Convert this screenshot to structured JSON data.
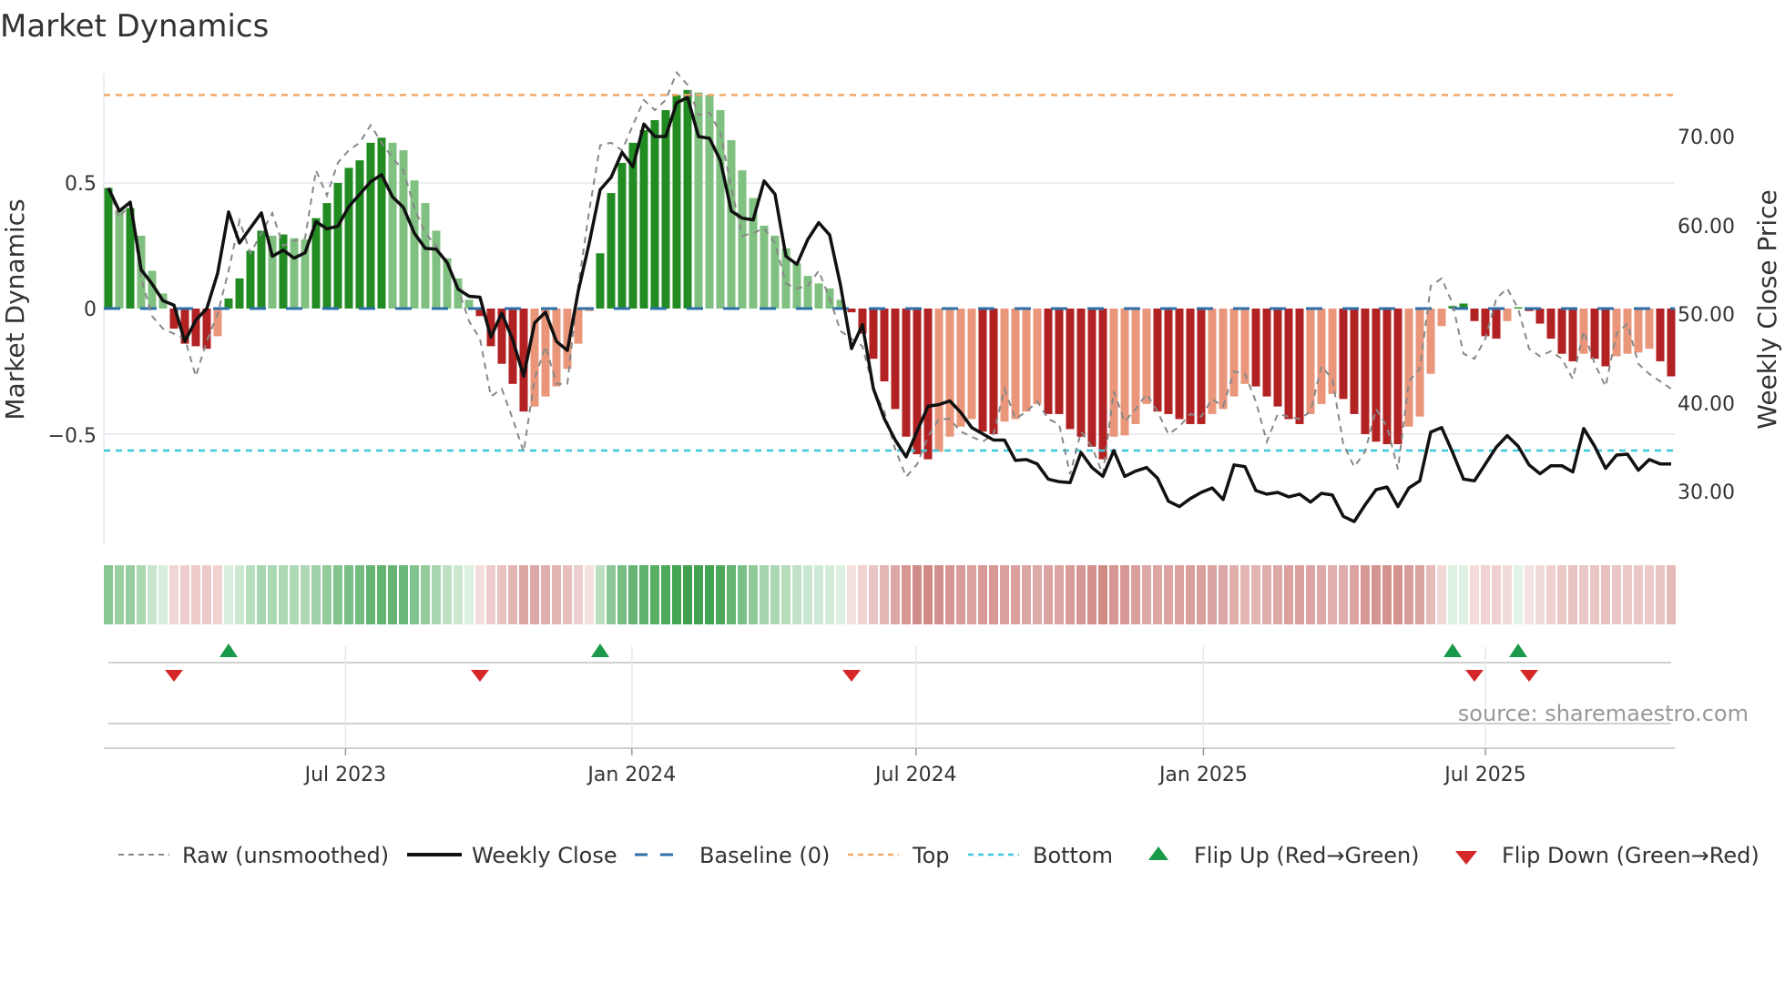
{
  "title": "Market Dynamics",
  "source": "source: sharemaestro.com",
  "chart_data": {
    "type": "bar",
    "title": "Market Dynamics",
    "ylabel": "Market Dynamics",
    "y2label": "Weekly Close Price",
    "xlabel": "",
    "frequency": "weekly",
    "ylim": [
      -0.84,
      1.0
    ],
    "y2lim": [
      24.5,
      77.5
    ],
    "y_ticks": [
      {
        "label": "0.5",
        "value": 0.5
      },
      {
        "label": "0",
        "value": 0
      },
      {
        "label": "−0.5",
        "value": -0.5
      }
    ],
    "y2_ticks": [
      {
        "label": "70.00",
        "value": 70
      },
      {
        "label": "60.00",
        "value": 60
      },
      {
        "label": "50.00",
        "value": 50
      },
      {
        "label": "40.00",
        "value": 40
      },
      {
        "label": "30.00",
        "value": 30
      }
    ],
    "x_ticks": [
      {
        "label": "Jul 2023",
        "week": 21.7
      },
      {
        "label": "Jan 2024",
        "week": 47.9
      },
      {
        "label": "Jul 2024",
        "week": 73.9
      },
      {
        "label": "Jan 2025",
        "week": 100.2
      },
      {
        "label": "Jul 2025",
        "week": 126.0
      }
    ],
    "reference_lines": {
      "baseline": 0,
      "top": 0.85,
      "bottom": -0.565
    },
    "momentum": [
      0.48,
      0.39,
      0.4,
      0.29,
      0.15,
      0.06,
      -0.08,
      -0.14,
      -0.15,
      -0.16,
      -0.11,
      0.04,
      0.12,
      0.23,
      0.31,
      0.29,
      0.295,
      0.28,
      0.275,
      0.36,
      0.42,
      0.5,
      0.56,
      0.59,
      0.66,
      0.68,
      0.66,
      0.63,
      0.51,
      0.42,
      0.31,
      0.2,
      0.12,
      0.035,
      -0.03,
      -0.15,
      -0.22,
      -0.3,
      -0.41,
      -0.39,
      -0.35,
      -0.31,
      -0.24,
      -0.14,
      -0.01,
      0.22,
      0.46,
      0.58,
      0.66,
      0.71,
      0.75,
      0.79,
      0.85,
      0.87,
      0.86,
      0.85,
      0.79,
      0.67,
      0.55,
      0.44,
      0.33,
      0.29,
      0.24,
      0.18,
      0.13,
      0.1,
      0.08,
      0.035,
      -0.015,
      -0.1,
      -0.2,
      -0.29,
      -0.4,
      -0.51,
      -0.58,
      -0.6,
      -0.57,
      -0.51,
      -0.47,
      -0.44,
      -0.49,
      -0.5,
      -0.45,
      -0.44,
      -0.41,
      -0.38,
      -0.42,
      -0.42,
      -0.48,
      -0.51,
      -0.55,
      -0.6,
      -0.51,
      -0.505,
      -0.46,
      -0.38,
      -0.41,
      -0.42,
      -0.44,
      -0.46,
      -0.46,
      -0.42,
      -0.4,
      -0.35,
      -0.3,
      -0.31,
      -0.35,
      -0.39,
      -0.44,
      -0.46,
      -0.42,
      -0.38,
      -0.34,
      -0.36,
      -0.42,
      -0.5,
      -0.53,
      -0.54,
      -0.54,
      -0.47,
      -0.43,
      -0.26,
      -0.07,
      0.01,
      0.02,
      -0.05,
      -0.11,
      -0.12,
      -0.05,
      0.005,
      -0.01,
      -0.06,
      -0.12,
      -0.18,
      -0.21,
      -0.18,
      -0.2,
      -0.23,
      -0.19,
      -0.18,
      -0.175,
      -0.16,
      -0.21,
      -0.27
    ],
    "raw": [
      0.48,
      0.36,
      0.42,
      0.12,
      -0.03,
      -0.08,
      -0.1,
      -0.12,
      -0.27,
      -0.13,
      -0.02,
      0.15,
      0.35,
      0.22,
      0.3,
      0.38,
      0.25,
      0.27,
      0.28,
      0.55,
      0.45,
      0.58,
      0.63,
      0.66,
      0.73,
      0.66,
      0.6,
      0.55,
      0.4,
      0.3,
      0.25,
      0.18,
      0.08,
      -0.05,
      -0.12,
      -0.35,
      -0.32,
      -0.44,
      -0.57,
      -0.28,
      -0.15,
      -0.3,
      -0.3,
      0.09,
      0.39,
      0.65,
      0.66,
      0.63,
      0.73,
      0.83,
      0.79,
      0.83,
      0.94,
      0.89,
      0.77,
      0.78,
      0.7,
      0.48,
      0.29,
      0.3,
      0.32,
      0.26,
      0.1,
      0.08,
      0.09,
      0.15,
      0.04,
      -0.09,
      -0.12,
      -0.15,
      -0.32,
      -0.41,
      -0.56,
      -0.67,
      -0.62,
      -0.51,
      -0.44,
      -0.44,
      -0.49,
      -0.51,
      -0.53,
      -0.5,
      -0.32,
      -0.44,
      -0.41,
      -0.37,
      -0.44,
      -0.46,
      -0.66,
      -0.49,
      -0.55,
      -0.66,
      -0.33,
      -0.45,
      -0.4,
      -0.34,
      -0.41,
      -0.5,
      -0.47,
      -0.42,
      -0.43,
      -0.36,
      -0.39,
      -0.25,
      -0.26,
      -0.37,
      -0.53,
      -0.42,
      -0.43,
      -0.44,
      -0.41,
      -0.23,
      -0.28,
      -0.54,
      -0.63,
      -0.57,
      -0.4,
      -0.47,
      -0.64,
      -0.29,
      -0.24,
      0.09,
      0.12,
      0.02,
      -0.18,
      -0.2,
      -0.12,
      0.04,
      0.08,
      0.0,
      -0.16,
      -0.19,
      -0.17,
      -0.2,
      -0.28,
      -0.09,
      -0.22,
      -0.31,
      -0.1,
      -0.06,
      -0.22,
      -0.26,
      -0.29,
      -0.32
    ],
    "weekly_close": [
      64.2,
      61.6,
      62.6,
      55.0,
      53.4,
      51.5,
      51.0,
      46.9,
      49.3,
      50.6,
      54.6,
      61.5,
      58.0,
      59.7,
      61.4,
      56.5,
      57.2,
      56.3,
      56.9,
      60.4,
      59.6,
      59.9,
      62.1,
      63.5,
      64.9,
      65.7,
      63.2,
      62.0,
      59.1,
      57.4,
      57.3,
      55.8,
      52.8,
      52.0,
      51.9,
      47.4,
      50.1,
      47.1,
      43.0,
      49.0,
      50.2,
      46.9,
      45.9,
      52.6,
      58.0,
      64.0,
      65.4,
      68.2,
      66.6,
      71.4,
      70.0,
      70.0,
      73.8,
      74.4,
      70.0,
      69.8,
      67.3,
      61.6,
      60.8,
      60.6,
      65.0,
      63.5,
      56.5,
      55.6,
      58.4,
      60.3,
      58.9,
      53.2,
      46.1,
      48.8,
      41.6,
      38.2,
      35.8,
      33.9,
      36.8,
      39.6,
      39.8,
      40.2,
      38.9,
      37.2,
      36.5,
      35.8,
      35.8,
      33.5,
      33.6,
      33.1,
      31.4,
      31.1,
      31.0,
      34.4,
      32.7,
      31.7,
      34.6,
      31.7,
      32.3,
      32.7,
      31.5,
      28.9,
      28.3,
      29.2,
      29.9,
      30.4,
      29.1,
      33.0,
      32.8,
      30.1,
      29.7,
      29.9,
      29.4,
      29.7,
      28.8,
      29.8,
      29.6,
      27.2,
      26.6,
      28.5,
      30.2,
      30.5,
      28.3,
      30.4,
      31.2,
      36.7,
      37.2,
      34.4,
      31.4,
      31.2,
      33.1,
      35.0,
      36.3,
      35.1,
      33.0,
      32.0,
      32.9,
      32.9,
      32.2,
      37.1,
      35.1,
      32.6,
      34.1,
      34.2,
      32.4,
      33.6,
      33.1,
      33.1
    ],
    "flip_up_weeks": [
      11,
      45,
      123,
      129
    ],
    "flip_down_weeks": [
      6,
      34,
      68,
      125,
      130
    ],
    "colors": {
      "green_strong": "#228b22",
      "green_weak": "#80c080",
      "red_strong": "#b22222",
      "red_weak": "#e9967a",
      "close": "#111111",
      "raw": "#888888",
      "baseline": "#2f6fa8",
      "top": "#f0a868",
      "bottom": "#3cc8d8",
      "flip_up": "#1a9a4a",
      "flip_down": "#d62728"
    },
    "legend": {
      "placement": "bottom",
      "items": [
        {
          "key": "raw",
          "label": "Raw (unsmoothed)"
        },
        {
          "key": "close",
          "label": "Weekly Close"
        },
        {
          "key": "baseline",
          "label": "Baseline (0)"
        },
        {
          "key": "top",
          "label": "Top"
        },
        {
          "key": "bottom",
          "label": "Bottom"
        },
        {
          "key": "flip_up",
          "label": "Flip Up (Red→Green)"
        },
        {
          "key": "flip_down",
          "label": "Flip Down (Green→Red)"
        }
      ]
    }
  }
}
